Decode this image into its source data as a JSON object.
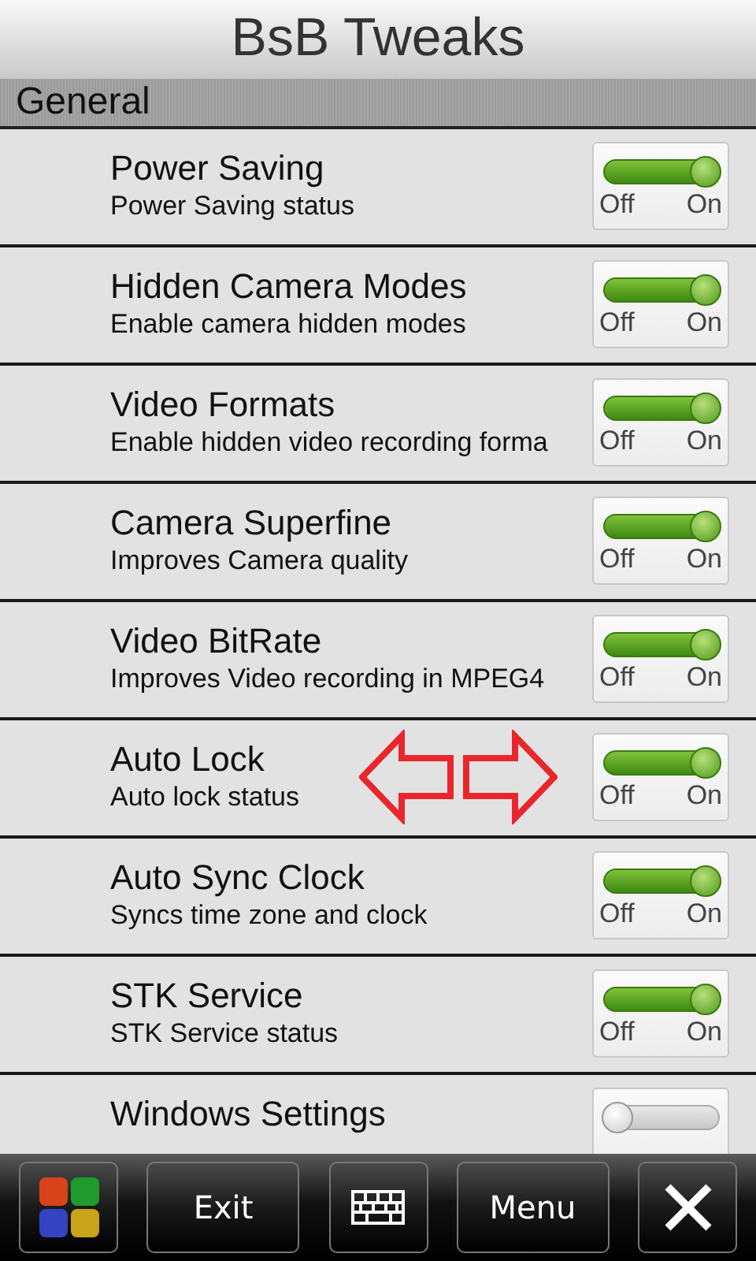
{
  "app": {
    "title": "BsB Tweaks"
  },
  "section": {
    "title": "General"
  },
  "settings": [
    {
      "title": "Power Saving",
      "subtitle": "Power Saving status",
      "on": true,
      "off_label": "Off",
      "on_label": "On"
    },
    {
      "title": "Hidden Camera Modes",
      "subtitle": "Enable camera hidden modes",
      "on": true,
      "off_label": "Off",
      "on_label": "On"
    },
    {
      "title": "Video Formats",
      "subtitle": "Enable hidden video recording forma",
      "on": true,
      "off_label": "Off",
      "on_label": "On"
    },
    {
      "title": "Camera Superfine",
      "subtitle": "Improves Camera quality",
      "on": true,
      "off_label": "Off",
      "on_label": "On"
    },
    {
      "title": "Video BitRate",
      "subtitle": "Improves Video recording in MPEG4",
      "on": true,
      "off_label": "Off",
      "on_label": "On"
    },
    {
      "title": "Auto Lock",
      "subtitle": "Auto lock status",
      "on": true,
      "off_label": "Off",
      "on_label": "On",
      "arrows": true
    },
    {
      "title": "Auto Sync Clock",
      "subtitle": "Syncs time zone and clock",
      "on": true,
      "off_label": "Off",
      "on_label": "On"
    },
    {
      "title": "STK Service",
      "subtitle": "STK Service status",
      "on": true,
      "off_label": "Off",
      "on_label": "On"
    },
    {
      "title": "Windows Settings",
      "on": false
    }
  ],
  "toolbar": [
    {
      "kind": "start"
    },
    {
      "kind": "text",
      "label": "Exit"
    },
    {
      "kind": "keyboard"
    },
    {
      "kind": "text",
      "label": "Menu"
    },
    {
      "kind": "close"
    }
  ]
}
